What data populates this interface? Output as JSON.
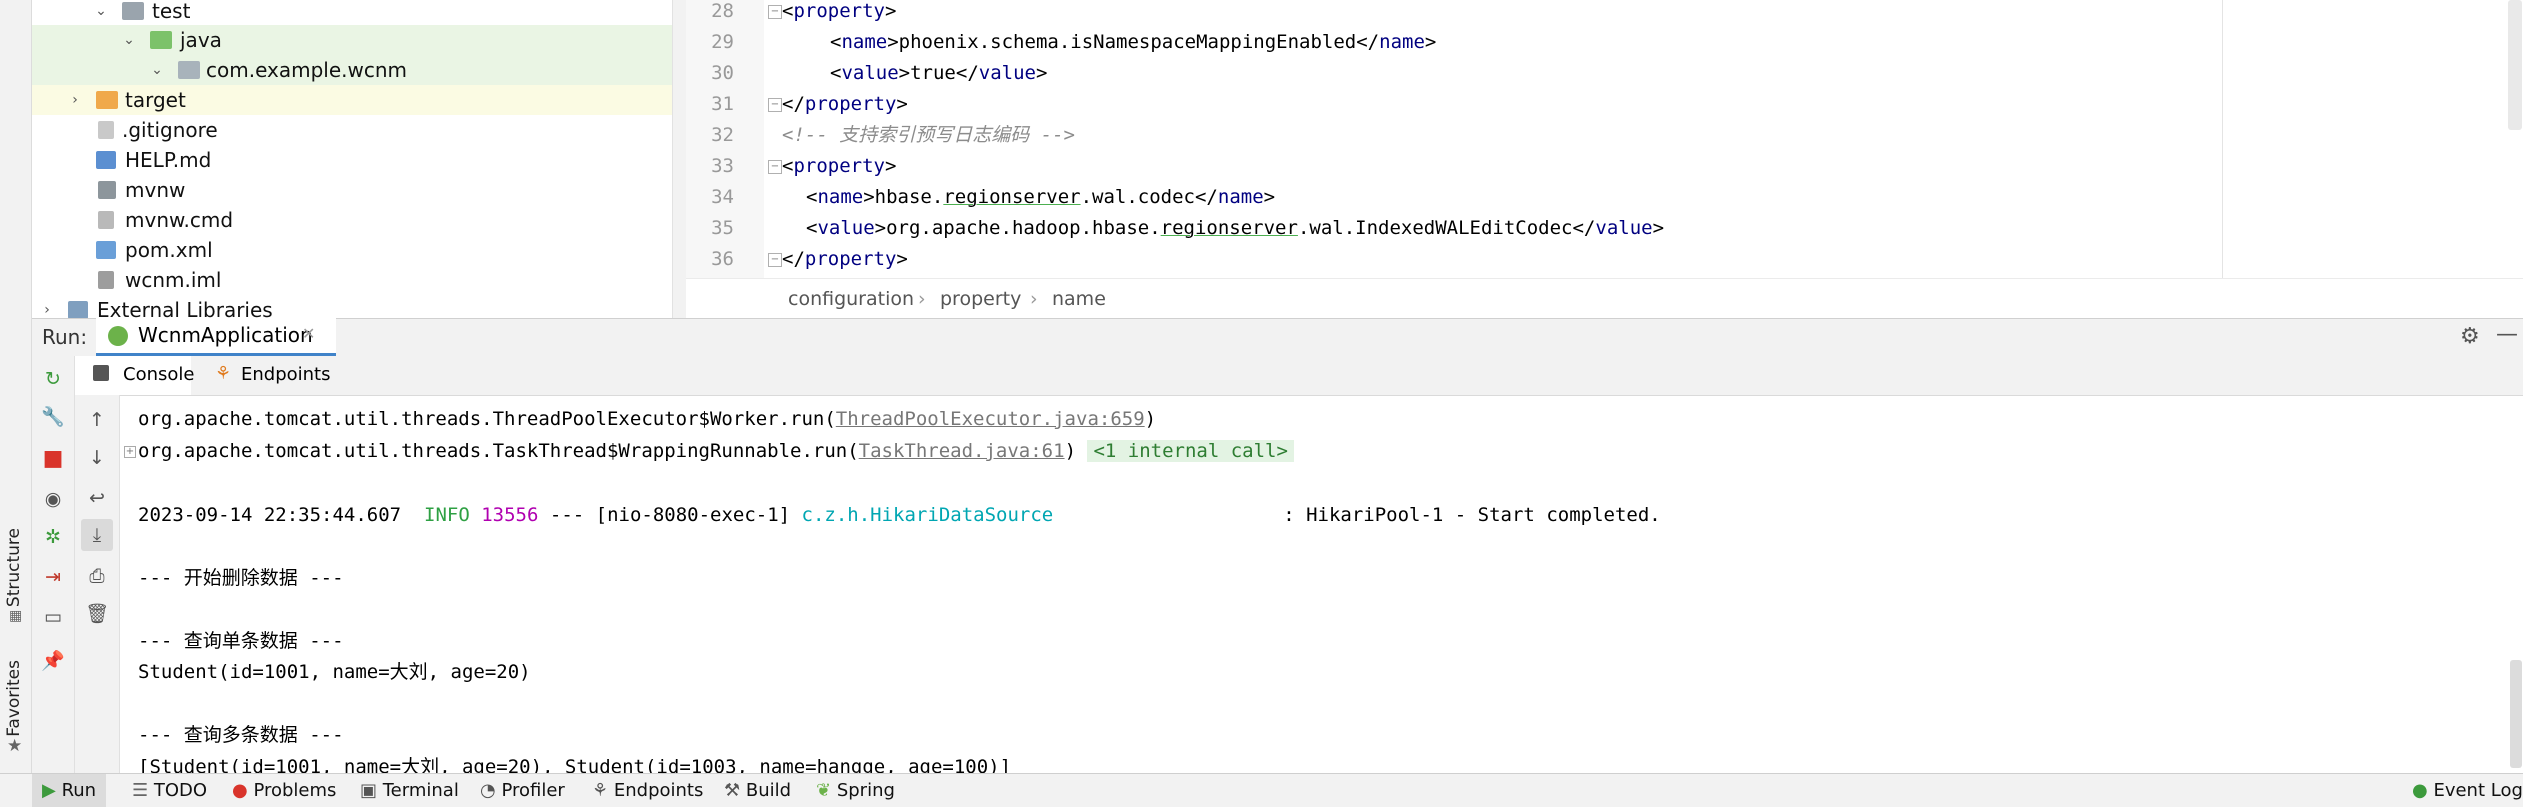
{
  "side_strip": {
    "structure_label": "Structure",
    "favorites_label": "Favorites"
  },
  "tree": [
    {
      "label": "test",
      "icon": "folder-icon",
      "expanded": true
    },
    {
      "label": "java",
      "icon": "source-folder-icon",
      "expanded": true
    },
    {
      "label": "com.example.wcnm",
      "icon": "package-icon",
      "expanded": true
    },
    {
      "label": "target",
      "icon": "folder-icon",
      "expanded": false
    },
    {
      "label": ".gitignore",
      "icon": "file-icon"
    },
    {
      "label": "HELP.md",
      "icon": "markdown-file-icon"
    },
    {
      "label": "mvnw",
      "icon": "script-file-icon"
    },
    {
      "label": "mvnw.cmd",
      "icon": "file-icon"
    },
    {
      "label": "pom.xml",
      "icon": "maven-file-icon"
    },
    {
      "label": "wcnm.iml",
      "icon": "iml-file-icon"
    },
    {
      "label": "External Libraries",
      "icon": "libraries-icon",
      "expanded": false
    }
  ],
  "editor": {
    "line_numbers": [
      "28",
      "29",
      "30",
      "31",
      "32",
      "33",
      "34",
      "35",
      "36"
    ],
    "lines": {
      "l28_tag": "property",
      "l29_name": "phoenix.schema.isNamespaceMappingEnabled",
      "l30_value": "true",
      "l31_tag": "property",
      "l32_comment": "<!-- 支持索引预写日志编码 -->",
      "l33_tag": "property",
      "l34_name_a": "hbase.",
      "l34_name_b": "regionserver",
      "l34_name_c": ".wal.codec",
      "l35_value_a": "org.apache.hadoop.hbase.",
      "l35_value_b": "regionserver",
      "l35_value_c": ".wal.IndexedWALEditCodec",
      "l36_tag": "property",
      "name_tag": "name",
      "value_tag": "value"
    },
    "breadcrumb": [
      "configuration",
      "property",
      "name"
    ],
    "breadcrumb_sep": "›"
  },
  "run": {
    "label": "Run:",
    "tab_title": "WcnmApplication",
    "console_tab": "Console",
    "endpoints_tab": "Endpoints",
    "console": {
      "line1_a": "org.apache.tomcat.util.threads.ThreadPoolExecutor$Worker.run(",
      "line1_link": "ThreadPoolExecutor.java:659",
      "line1_b": ")",
      "line2_a": "org.apache.tomcat.util.threads.TaskThread$WrappingRunnable.run(",
      "line2_link": "TaskThread.java:61",
      "line2_b": ")",
      "line2_internal": "<1 internal call>",
      "log_ts": "2023-09-14 22:35:44.607",
      "log_level": "INFO",
      "log_pid": "13556",
      "log_thread": "--- [nio-8080-exec-1]",
      "log_logger": "c.z.h.HikariDataSource",
      "log_msg": ": HikariPool-1 - Start completed.",
      "delete_header": "--- 开始删除数据 ---",
      "query_one_header": "--- 查询单条数据 ---",
      "student_one": "Student(id=1001, name=大刘, age=20)",
      "query_many_header": "--- 查询多条数据 ---",
      "student_list": "[Student(id=1001, name=大刘, age=20), Student(id=1003, name=hangge, age=100)]"
    }
  },
  "status_bar": {
    "run": "Run",
    "todo": "TODO",
    "problems": "Problems",
    "terminal": "Terminal",
    "profiler": "Profiler",
    "endpoints": "Endpoints",
    "build": "Build",
    "spring": "Spring",
    "event_log": "Event Log"
  },
  "colors": {
    "accent": "#4083c9",
    "tag": "#000080",
    "info": "#2ea043",
    "pid": "#b000b0",
    "logger": "#00a6b2"
  }
}
